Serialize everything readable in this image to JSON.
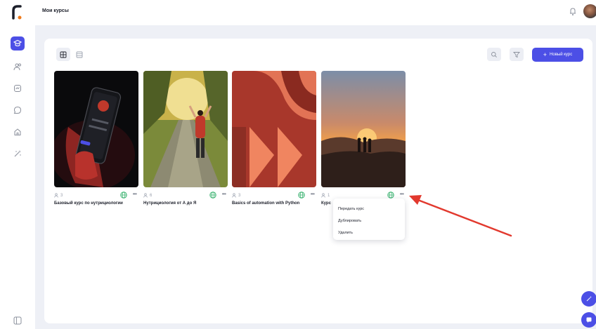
{
  "header": {
    "page_title": "Мои курсы"
  },
  "sidebar": {
    "items": [
      {
        "icon": "courses-icon",
        "active": true
      },
      {
        "icon": "users-icon",
        "active": false
      },
      {
        "icon": "chart-icon",
        "active": false
      },
      {
        "icon": "chat-icon",
        "active": false
      },
      {
        "icon": "home-icon",
        "active": false
      },
      {
        "icon": "magic-wand-icon",
        "active": false
      }
    ]
  },
  "toolbar": {
    "new_course_label": "Новый курс",
    "new_course_icon": "+"
  },
  "courses": [
    {
      "students": "3",
      "title": "Базовый курс по нутрициологии"
    },
    {
      "students": "6",
      "title": "Нутрициология от А до Я"
    },
    {
      "students": "3",
      "title": "Basics of automation with Python"
    },
    {
      "students": "1",
      "title": "Курс"
    }
  ],
  "context_menu": {
    "items": [
      "Передать курс",
      "Дублировать",
      "Удалить"
    ]
  },
  "colors": {
    "accent": "#4c4fe6",
    "published": "#3cb371",
    "annotation_arrow": "#e2392e"
  }
}
